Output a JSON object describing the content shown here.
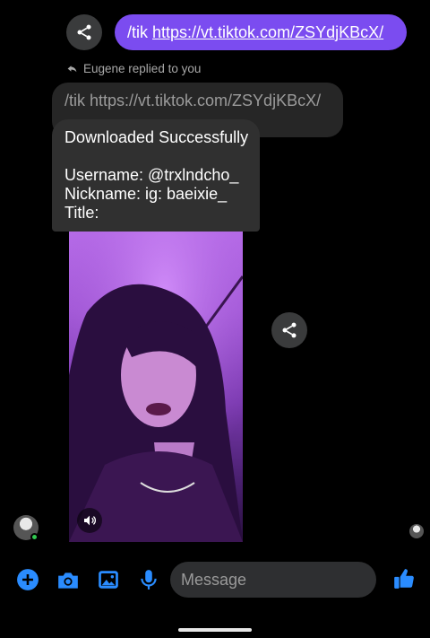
{
  "outgoing": {
    "prefix": "/tik",
    "link": "https://vt.tiktok.com/ZSYdjKBcX/"
  },
  "reply_note": {
    "text": "Eugene replied to you",
    "icon": "reply-arrow-icon"
  },
  "quoted_message": {
    "text": "/tik https://vt.tiktok.com/ZSYdjKBcX/"
  },
  "incoming": {
    "status": "Downloaded Successfully",
    "username": "Username: @trxlndcho_",
    "nickname": "Nickname: ig: baeixie_",
    "title": "Title:"
  },
  "composer": {
    "placeholder": "Message"
  },
  "icons": {
    "share": "share-icon",
    "mute": "speaker-icon",
    "plus": "plus-icon",
    "camera": "camera-icon",
    "gallery": "image-icon",
    "mic": "microphone-icon",
    "emoji": "emoji-icon",
    "like": "thumbs-up-icon"
  },
  "colors": {
    "accent": "#7b4cf0",
    "messenger_blue": "#2a8cff",
    "bubble_in": "#303030",
    "online": "#31c950"
  }
}
